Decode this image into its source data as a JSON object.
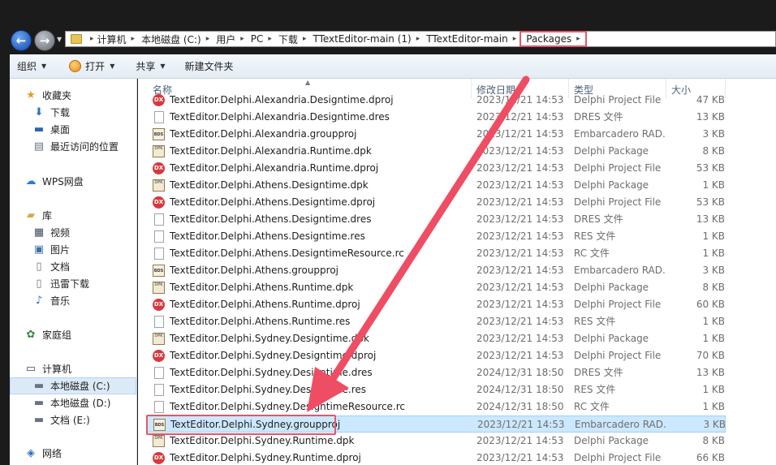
{
  "addressbar": {
    "crumbs": [
      "计算机",
      "本地磁盘 (C:)",
      "用户",
      "PC",
      "下载",
      "TTextEditor-main (1)",
      "TTextEditor-main",
      "Packages"
    ]
  },
  "toolbar": {
    "organize": "组织",
    "open": "打开",
    "share": "共享",
    "new_folder": "新建文件夹"
  },
  "navpane": {
    "favorites": "收藏夹",
    "downloads": "下载",
    "desktop": "桌面",
    "recent": "最近访问的位置",
    "wps": "WPS网盘",
    "libraries": "库",
    "videos": "视频",
    "pictures": "图片",
    "documents": "文档",
    "xunlei": "迅雷下载",
    "music": "音乐",
    "homegroup": "家庭组",
    "computer": "计算机",
    "drive_c": "本地磁盘 (C:)",
    "drive_d": "本地磁盘 (D:)",
    "drive_e": "文档 (E:)",
    "network": "网络"
  },
  "columns": {
    "name": "名称",
    "date": "修改日期",
    "type": "类型",
    "size": "大小"
  },
  "files": [
    {
      "name": "TextEditor.Delphi.Alexandria.Designtime.dproj",
      "date": "2023/12/21 14:53",
      "type": "Delphi Project File",
      "size": "47 KB",
      "icon": "dx"
    },
    {
      "name": "TextEditor.Delphi.Alexandria.Designtime.dres",
      "date": "2023/12/21 14:53",
      "type": "DRES 文件",
      "size": "13 KB",
      "icon": "page"
    },
    {
      "name": "TextEditor.Delphi.Alexandria.groupproj",
      "date": "2023/12/21 14:53",
      "type": "Embarcadero RAD...",
      "size": "3 KB",
      "icon": "bds"
    },
    {
      "name": "TextEditor.Delphi.Alexandria.Runtime.dpk",
      "date": "2023/12/21 14:53",
      "type": "Delphi Package",
      "size": "8 KB",
      "icon": "pkg"
    },
    {
      "name": "TextEditor.Delphi.Alexandria.Runtime.dproj",
      "date": "2023/12/21 14:53",
      "type": "Delphi Project File",
      "size": "53 KB",
      "icon": "dx"
    },
    {
      "name": "TextEditor.Delphi.Athens.Designtime.dpk",
      "date": "2023/12/21 14:53",
      "type": "Delphi Package",
      "size": "1 KB",
      "icon": "pkg"
    },
    {
      "name": "TextEditor.Delphi.Athens.Designtime.dproj",
      "date": "2023/12/21 14:53",
      "type": "Delphi Project File",
      "size": "53 KB",
      "icon": "dx"
    },
    {
      "name": "TextEditor.Delphi.Athens.Designtime.dres",
      "date": "2023/12/21 14:53",
      "type": "DRES 文件",
      "size": "13 KB",
      "icon": "page"
    },
    {
      "name": "TextEditor.Delphi.Athens.Designtime.res",
      "date": "2023/12/21 14:53",
      "type": "RES 文件",
      "size": "1 KB",
      "icon": "page"
    },
    {
      "name": "TextEditor.Delphi.Athens.DesigntimeResource.rc",
      "date": "2023/12/21 14:53",
      "type": "RC 文件",
      "size": "1 KB",
      "icon": "page"
    },
    {
      "name": "TextEditor.Delphi.Athens.groupproj",
      "date": "2023/12/21 14:53",
      "type": "Embarcadero RAD...",
      "size": "3 KB",
      "icon": "bds"
    },
    {
      "name": "TextEditor.Delphi.Athens.Runtime.dpk",
      "date": "2023/12/21 14:53",
      "type": "Delphi Package",
      "size": "8 KB",
      "icon": "pkg"
    },
    {
      "name": "TextEditor.Delphi.Athens.Runtime.dproj",
      "date": "2023/12/21 14:53",
      "type": "Delphi Project File",
      "size": "60 KB",
      "icon": "dx"
    },
    {
      "name": "TextEditor.Delphi.Athens.Runtime.res",
      "date": "2023/12/21 14:53",
      "type": "RES 文件",
      "size": "1 KB",
      "icon": "page"
    },
    {
      "name": "TextEditor.Delphi.Sydney.Designtime.dpk",
      "date": "2023/12/21 14:53",
      "type": "Delphi Package",
      "size": "1 KB",
      "icon": "pkg"
    },
    {
      "name": "TextEditor.Delphi.Sydney.Designtime.dproj",
      "date": "2023/12/21 14:53",
      "type": "Delphi Project File",
      "size": "70 KB",
      "icon": "dx"
    },
    {
      "name": "TextEditor.Delphi.Sydney.Designtime.dres",
      "date": "2024/12/31 18:50",
      "type": "DRES 文件",
      "size": "13 KB",
      "icon": "page"
    },
    {
      "name": "TextEditor.Delphi.Sydney.Designtime.res",
      "date": "2024/12/31 18:50",
      "type": "RES 文件",
      "size": "1 KB",
      "icon": "page"
    },
    {
      "name": "TextEditor.Delphi.Sydney.DesigntimeResource.rc",
      "date": "2024/12/31 18:50",
      "type": "RC 文件",
      "size": "1 KB",
      "icon": "page"
    },
    {
      "name": "TextEditor.Delphi.Sydney.groupproj",
      "date": "2023/12/21 14:53",
      "type": "Embarcadero RAD...",
      "size": "3 KB",
      "icon": "bds",
      "selected": true
    },
    {
      "name": "TextEditor.Delphi.Sydney.Runtime.dpk",
      "date": "2023/12/21 14:53",
      "type": "Delphi Package",
      "size": "8 KB",
      "icon": "pkg"
    },
    {
      "name": "TextEditor.Delphi.Sydney.Runtime.dproj",
      "date": "2023/12/21 14:53",
      "type": "Delphi Project File",
      "size": "66 KB",
      "icon": "dx"
    }
  ],
  "colors": {
    "annotation": "#e5566b",
    "selection": "#cce8ff"
  }
}
